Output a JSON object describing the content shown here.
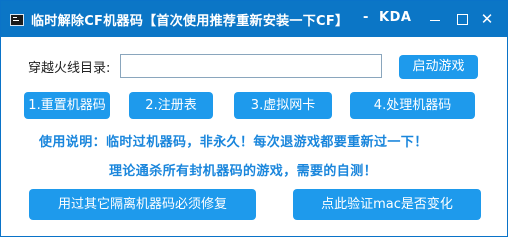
{
  "window": {
    "title": "临时解除CF机器码【首次使用推荐重新安装一下CF】",
    "separator": "-",
    "brand": "KDA",
    "minimize_symbol": "",
    "maximize_symbol": "",
    "close_symbol": "✕"
  },
  "form": {
    "dir_label": "穿越火线目录:",
    "dir_value": "",
    "launch_label": "启动游戏"
  },
  "actions": {
    "btn1": "1.重置机器码",
    "btn2": "2.注册表",
    "btn3": "3.虚拟网卡",
    "btn4": "4.处理机器码"
  },
  "notes": {
    "line1": "使用说明：临时过机器码，非永久！每次退游戏都要重新过一下！",
    "line2": "理论通杀所有封机器码的游戏，需要的自测！"
  },
  "bottom": {
    "repair_label": "用过其它隔离机器码必须修复",
    "verify_label": "点此验证mac是否变化"
  },
  "colors": {
    "titlebar": "#0b76c6",
    "button": "#1e9aec",
    "note_text": "#1a86dc"
  },
  "icons": {
    "app": "console-app-icon",
    "minimize": "minimize-icon",
    "maximize": "maximize-icon",
    "close": "close-icon"
  }
}
